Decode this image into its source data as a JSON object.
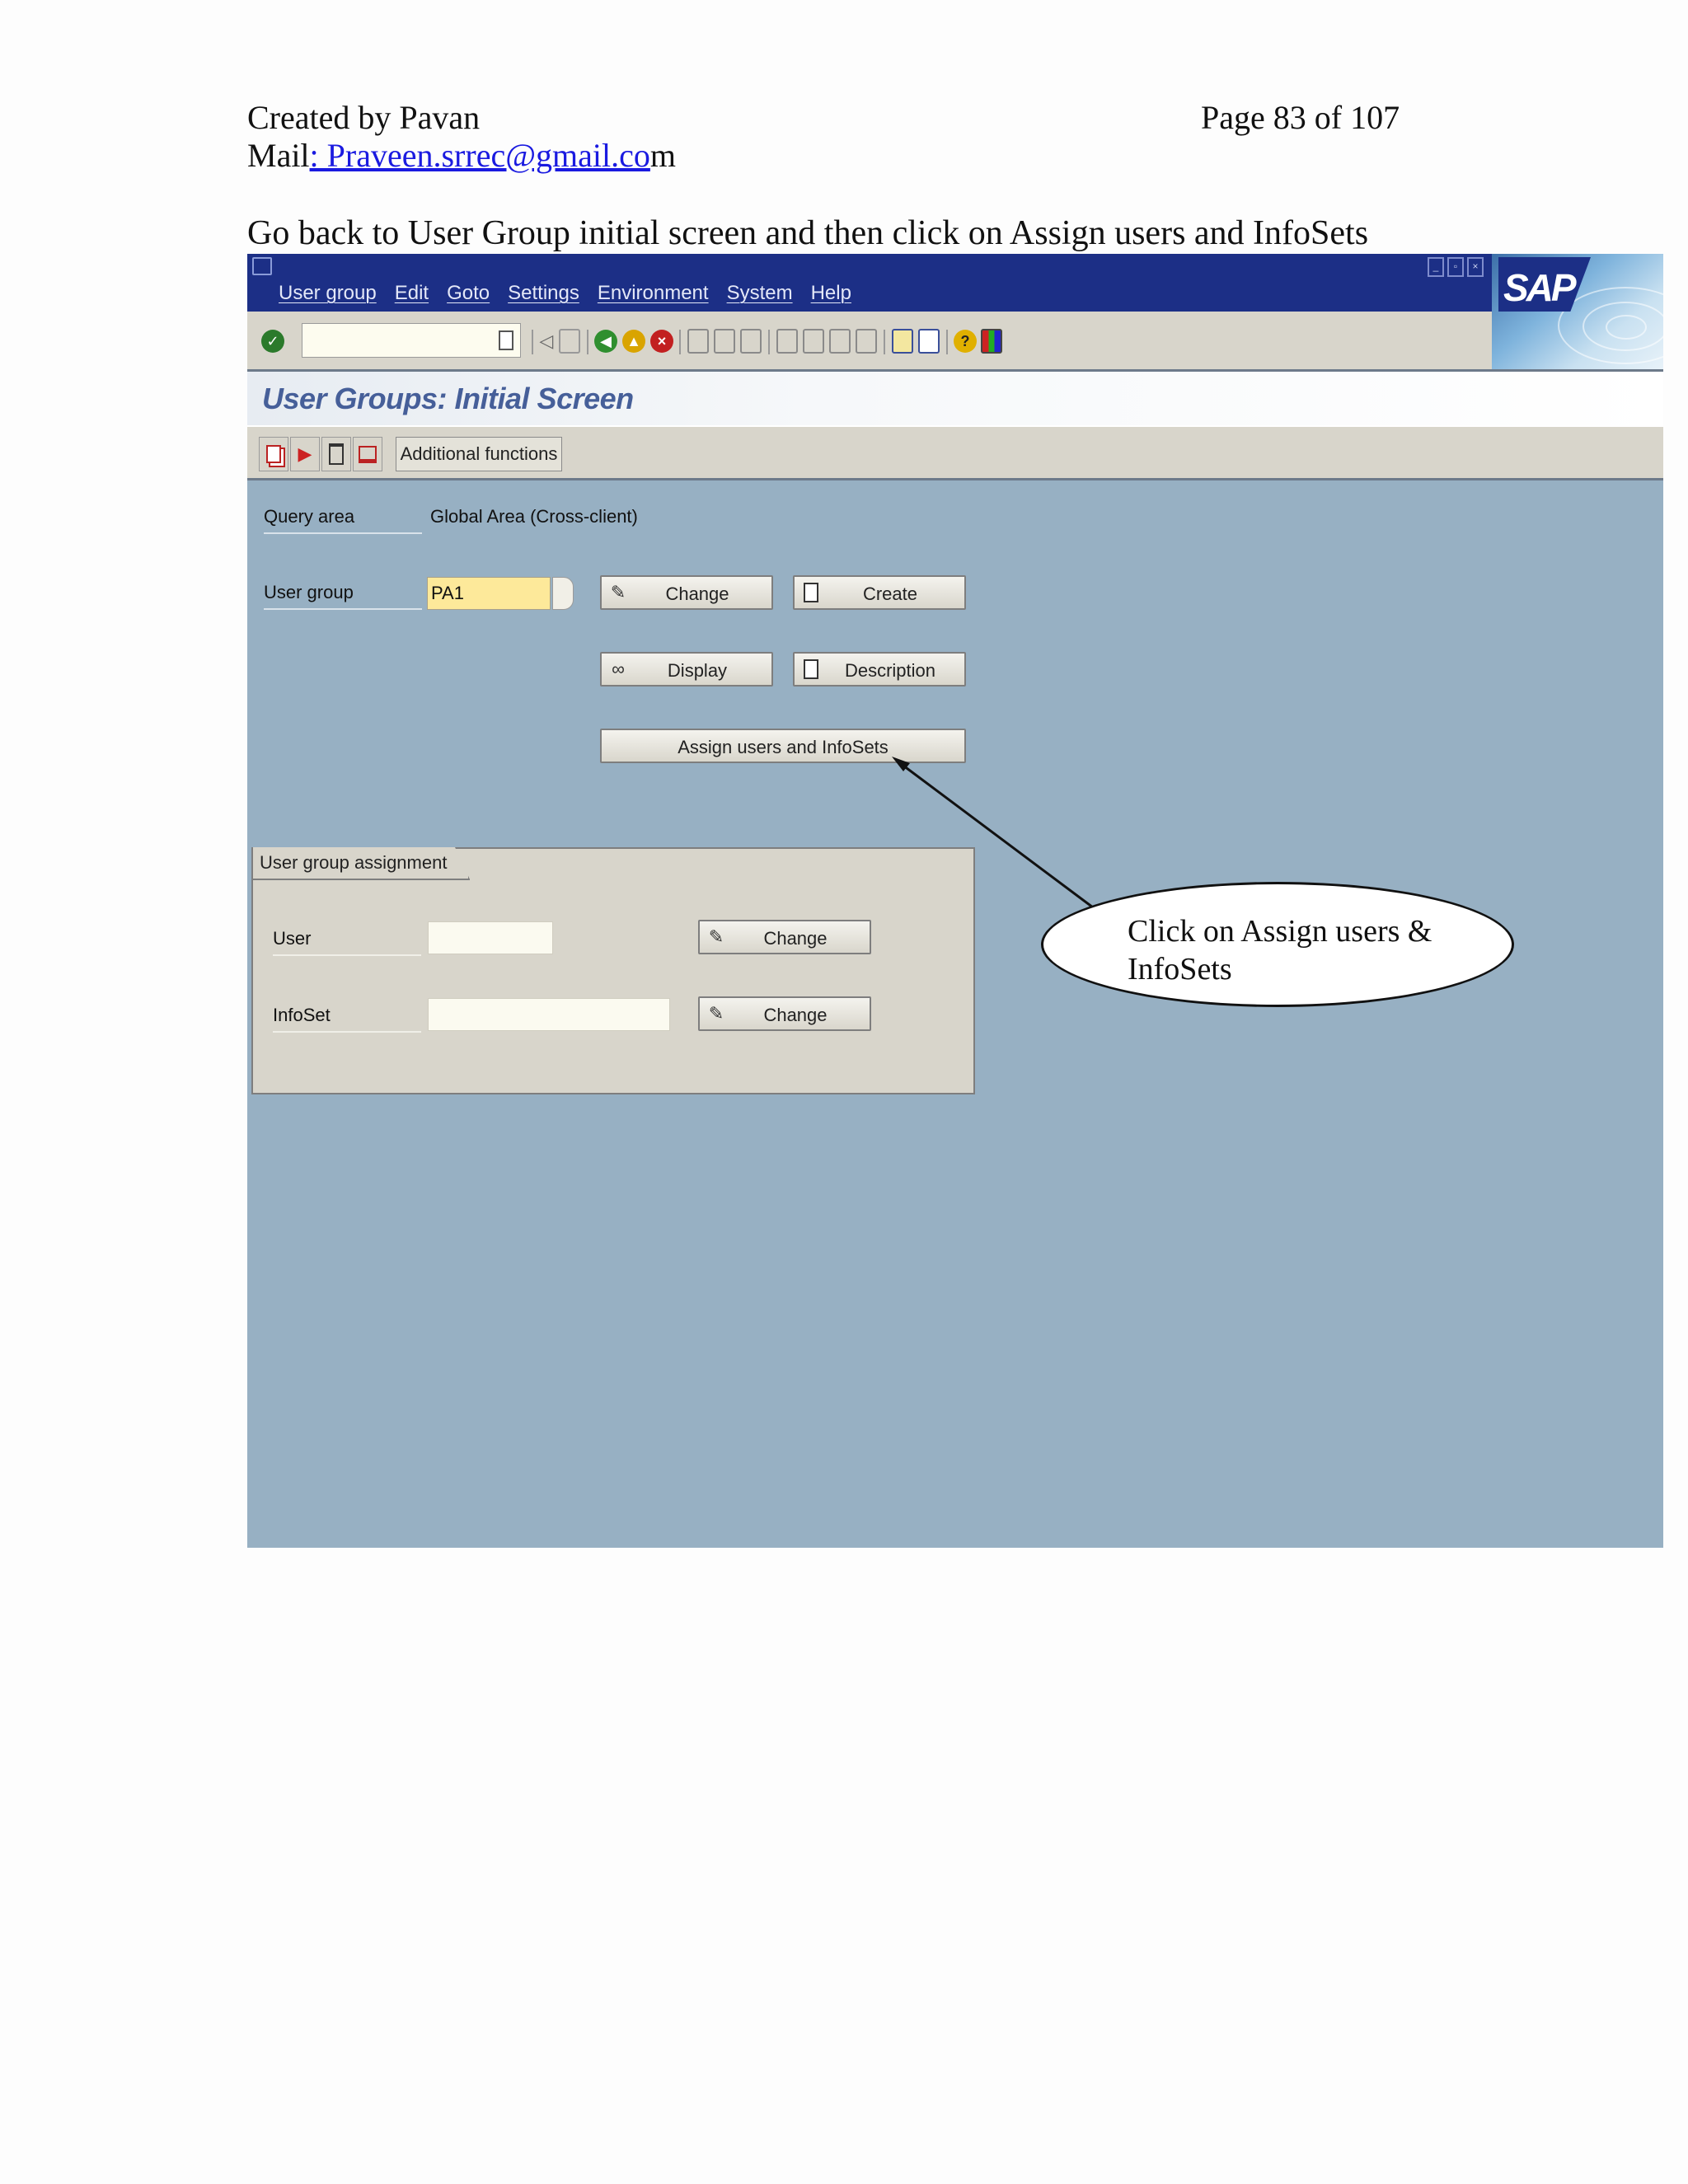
{
  "document": {
    "created_by": "Created by  Pavan",
    "page": "Page 83 of 107",
    "mail_prefix": "Mail",
    "mail_link": ": Praveen.srrec@gmail.co",
    "mail_suffix": "m",
    "instruction": "Go back to User Group initial screen and then click on Assign users and InfoSets"
  },
  "sap": {
    "logo": "SAP",
    "menu": [
      "User group",
      "Edit",
      "Goto",
      "Settings",
      "Environment",
      "System",
      "Help"
    ],
    "screen_title": "User Groups: Initial Screen",
    "app_toolbar": {
      "additional_functions": "Additional functions"
    },
    "form": {
      "query_area_label": "Query area",
      "query_area_value": "Global Area (Cross-client)",
      "user_group_label": "User group",
      "user_group_value": "PA1",
      "change": "Change",
      "create": "Create",
      "display": "Display",
      "description": "Description",
      "assign": "Assign users and InfoSets"
    },
    "assignment": {
      "tab": "User group assignment",
      "user_label": "User",
      "user_value": "",
      "infoset_label": "InfoSet",
      "infoset_value": "",
      "change": "Change"
    },
    "colors": {
      "title_bar": "#1c2f86",
      "background": "#97b0c3",
      "input_required": "#fde99a"
    }
  },
  "callout": {
    "text": "Click on Assign users & InfoSets"
  }
}
